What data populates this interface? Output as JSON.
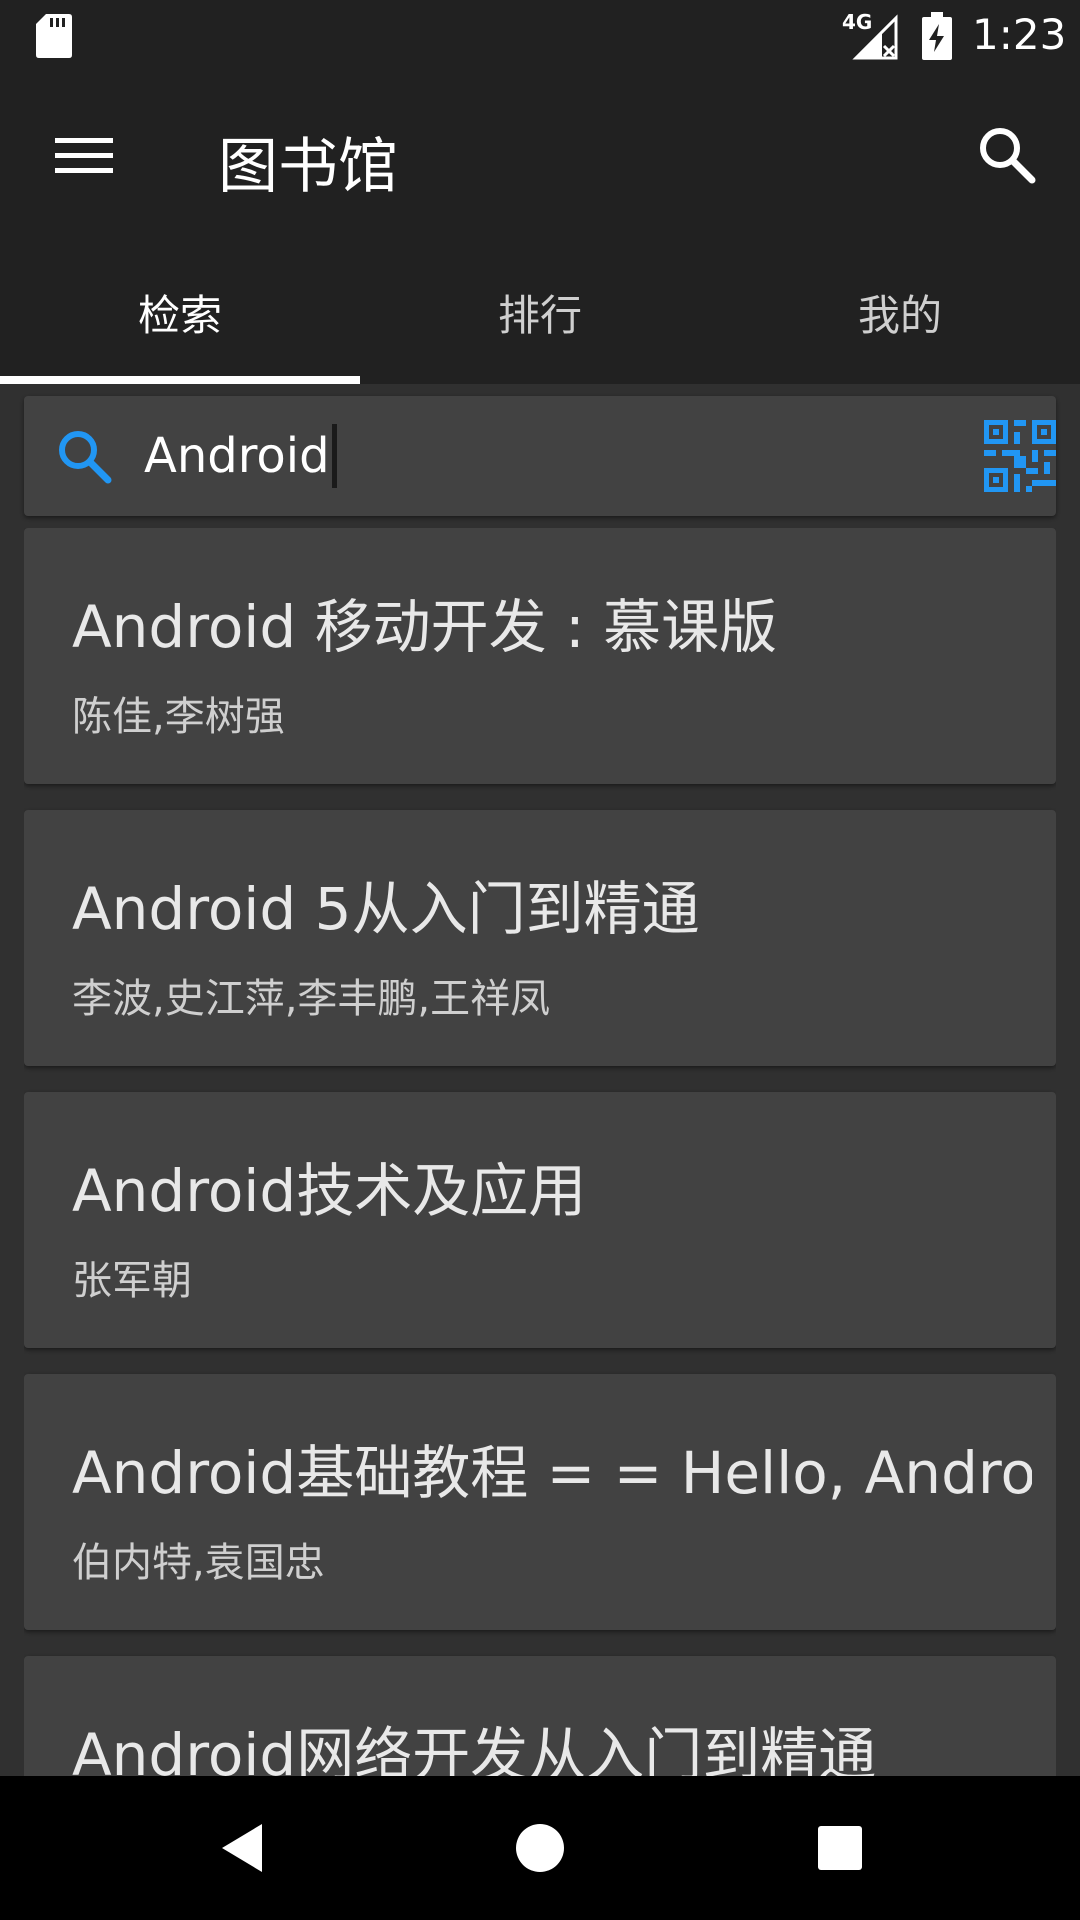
{
  "status_bar": {
    "network_label": "4G",
    "time": "1:23"
  },
  "app_bar": {
    "title": "图书馆",
    "menu_icon": "hamburger-menu-icon",
    "search_icon": "search-icon"
  },
  "tabs": [
    {
      "label": "检索",
      "active": true
    },
    {
      "label": "排行",
      "active": false
    },
    {
      "label": "我的",
      "active": false
    }
  ],
  "search": {
    "value": "Android",
    "search_icon": "search-icon",
    "scan_icon": "qr-code-icon",
    "accent_color": "#2196F3"
  },
  "books": [
    {
      "title": "Android 移动开发 : 慕课版",
      "authors": "陈佳,李树强"
    },
    {
      "title": "Android 5从入门到精通",
      "authors": "李波,史江萍,李丰鹏,王祥凤"
    },
    {
      "title": "Android技术及应用",
      "authors": "张军朝"
    },
    {
      "title": "Android基础教程 = = Hello, Androi..",
      "authors": "伯内特,袁国忠"
    },
    {
      "title": "Android网络开发从入门到精通",
      "authors": ""
    }
  ],
  "nav_bar": {
    "back_icon": "back-triangle-icon",
    "home_icon": "home-circle-icon",
    "recents_icon": "recents-square-icon"
  }
}
